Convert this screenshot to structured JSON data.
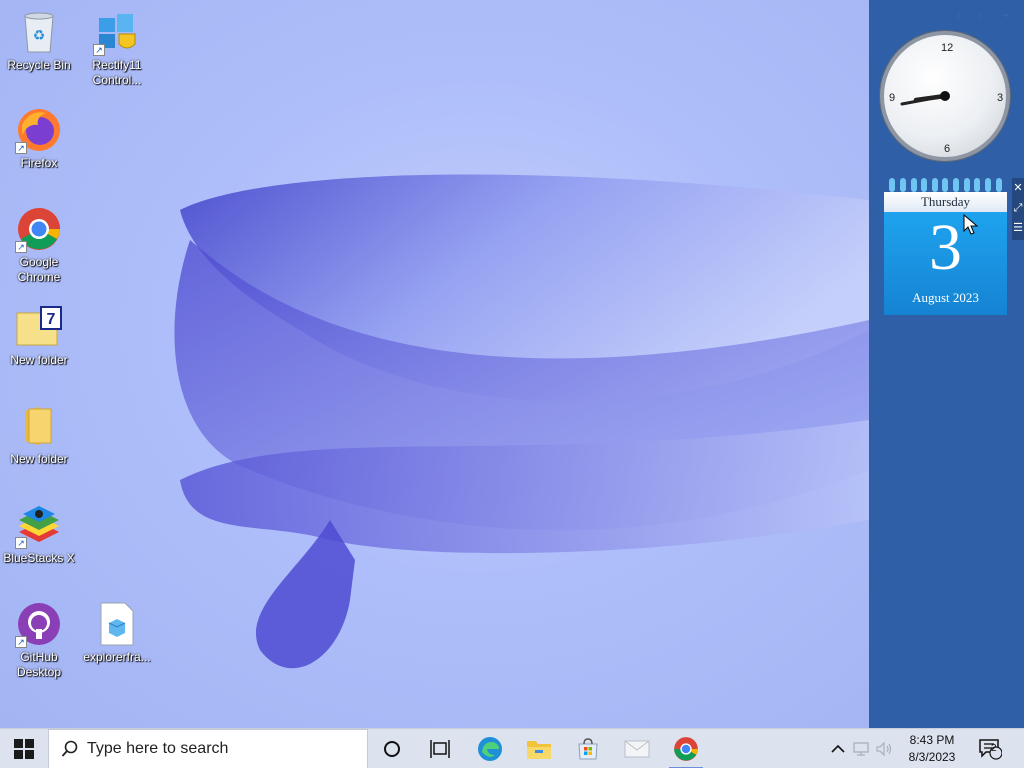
{
  "desktop_icons": [
    {
      "label": "Recycle Bin",
      "icon": "recycle-bin-icon"
    },
    {
      "label": "Rectify11 Control...",
      "icon": "control-panel-icon"
    },
    {
      "label": "Firefox",
      "icon": "firefox-icon"
    },
    {
      "label": "Google Chrome",
      "icon": "chrome-icon"
    },
    {
      "label": "New folder",
      "icon": "folder-7-icon"
    },
    {
      "label": "New folder",
      "icon": "folder-icon"
    },
    {
      "label": "BlueStacks X",
      "icon": "bluestacks-icon"
    },
    {
      "label": "GitHub Desktop",
      "icon": "github-icon"
    },
    {
      "label": "explorerfra...",
      "icon": "file-icon"
    }
  ],
  "clock_gadget": {
    "n12": "12",
    "n3": "3",
    "n6": "6",
    "n9": "9"
  },
  "calendar_gadget": {
    "weekday": "Thursday",
    "day": "3",
    "month_year": "August 2023"
  },
  "taskbar": {
    "search_placeholder": "Type here to search",
    "time": "8:43 PM",
    "date": "8/3/2023",
    "notification_count": "2"
  },
  "colors": {
    "accent": "#2f5fa6",
    "calendar": "#1b93e0"
  }
}
